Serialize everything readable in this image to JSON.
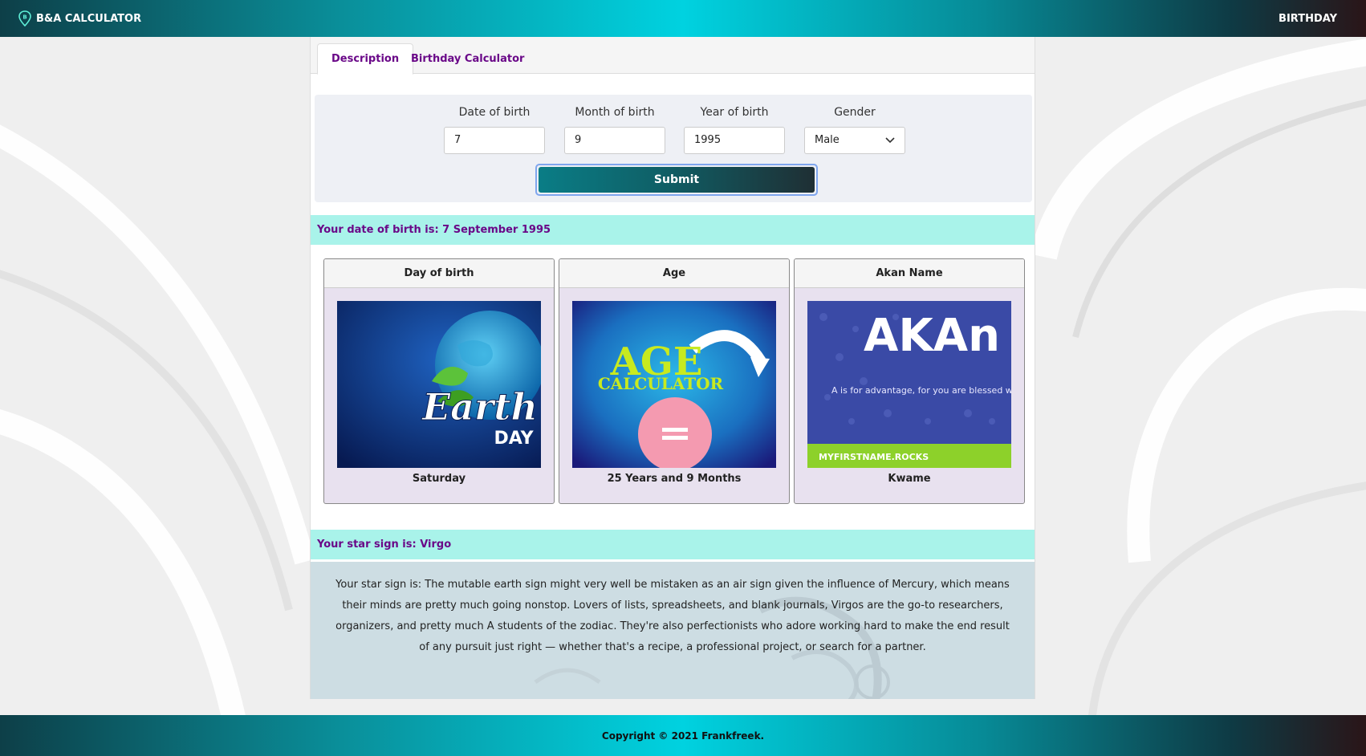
{
  "navbar": {
    "brand": "B&A CALCULATOR",
    "brand_icon": "map-pin-b-icon",
    "link": "BIRTHDAY"
  },
  "tabs": [
    {
      "label": "Description",
      "active": true
    },
    {
      "label": "Birthday Calculator",
      "active": false
    }
  ],
  "form": {
    "date_label": "Date of birth",
    "date_value": "7",
    "month_label": "Month of birth",
    "month_value": "9",
    "year_label": "Year of birth",
    "year_value": "1995",
    "gender_label": "Gender",
    "gender_value": "Male",
    "submit_label": "Submit"
  },
  "dob_bar": "Your date of birth is: 7 September 1995",
  "cards": [
    {
      "title": "Day of birth",
      "value": "Saturday",
      "image": "earth-day-image",
      "image_text": [
        "Earth",
        "DAY"
      ]
    },
    {
      "title": "Age",
      "value": "25 Years and 9 Months",
      "image": "age-calculator-image",
      "image_text": [
        "AGE",
        "CALCULATOR"
      ]
    },
    {
      "title": "Akan Name",
      "value": "Kwame",
      "image": "akan-image",
      "image_text": [
        "AKAn",
        "A is for advantage, for you are blessed with",
        "MYFIRSTNAME.ROCKS"
      ]
    }
  ],
  "star_bar": "Your star sign is: Virgo",
  "description": "Your star sign is: The mutable earth sign might very well be mistaken as an air sign given the influence of Mercury, which means their minds are pretty much going nonstop. Lovers of lists, spreadsheets, and blank journals, Virgos are the go-to researchers, organizers, and pretty much A students of the zodiac. They're also perfectionists who adore working hard to make the end result of any pursuit just right — whether that's a recipe, a professional project, or search for a partner.",
  "footer": "Copyright © 2021 Frankfreek.",
  "colors": {
    "accent_purple": "#6a0888",
    "info_bar": "#a9f3ea",
    "nav_teal": "#00d2e0"
  }
}
